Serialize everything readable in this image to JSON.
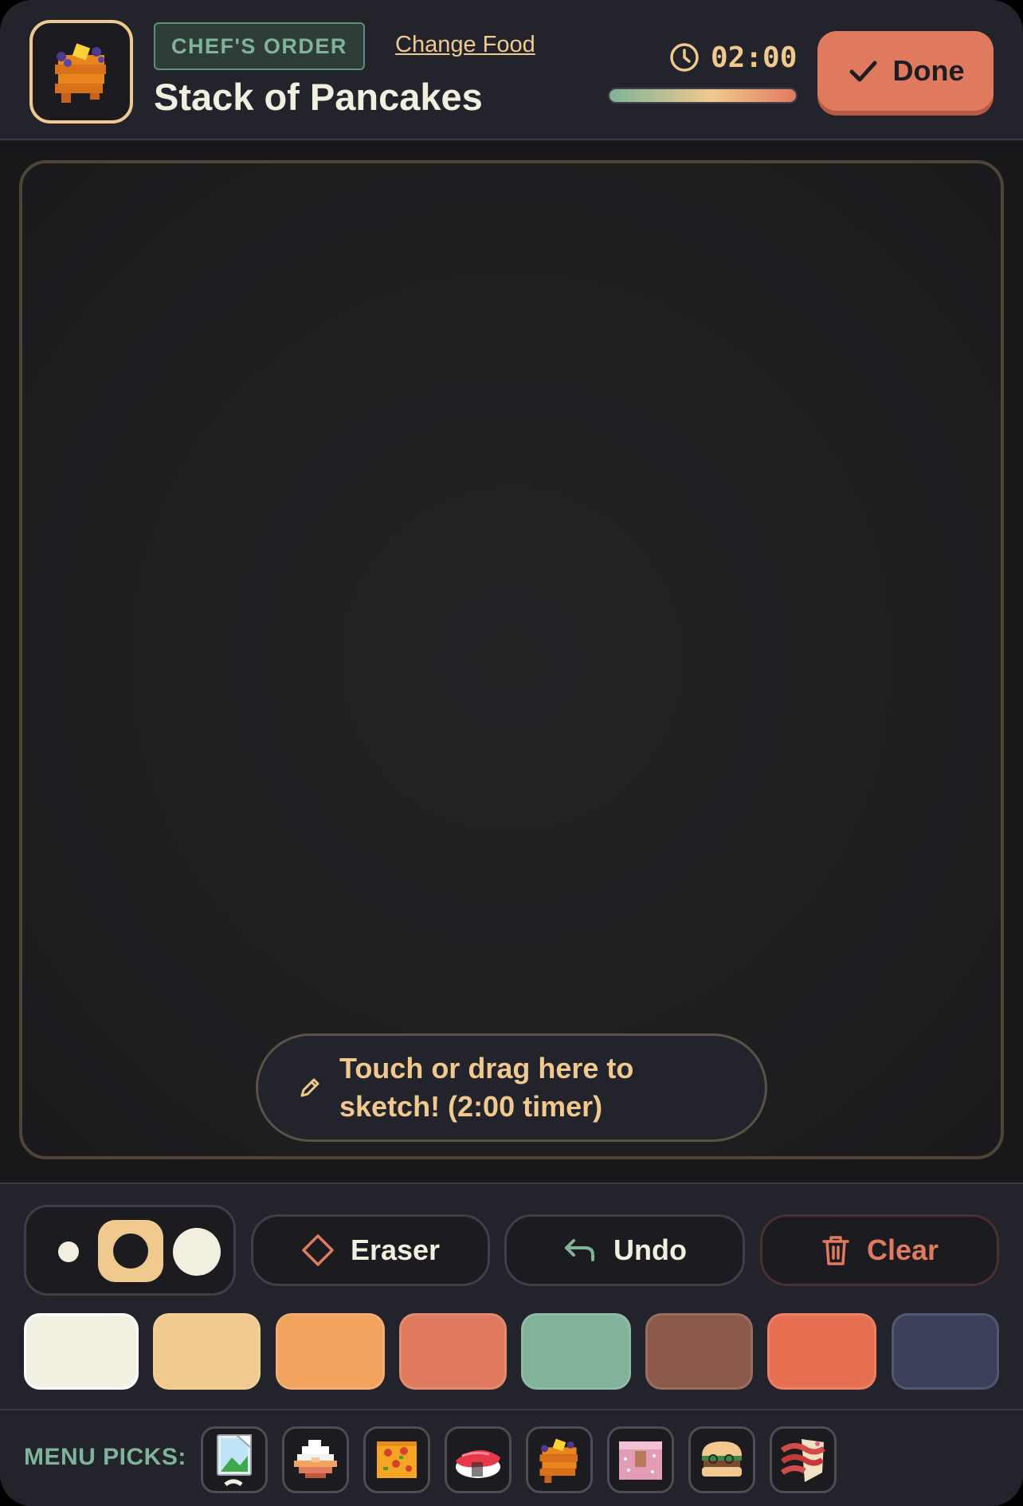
{
  "header": {
    "badge": "CHEF'S ORDER",
    "change_food": "Change Food",
    "title": "Stack of Pancakes",
    "timer": "02:00",
    "timer_progress": 1.0,
    "done_label": "Done"
  },
  "canvas": {
    "hint": "Touch or drag here to sketch! (2:00 timer)"
  },
  "toolbar": {
    "brush_sizes": [
      "small",
      "medium",
      "large"
    ],
    "selected_size": "medium",
    "eraser_label": "Eraser",
    "undo_label": "Undo",
    "clear_label": "Clear"
  },
  "palette": [
    {
      "color": "#f2f0e0",
      "selected": true
    },
    {
      "color": "#f0c98e",
      "selected": false
    },
    {
      "color": "#f2a35e",
      "selected": false
    },
    {
      "color": "#e07a5f",
      "selected": false
    },
    {
      "color": "#81b29a",
      "selected": false
    },
    {
      "color": "#8b5a4a",
      "selected": false
    },
    {
      "color": "#e76f51",
      "selected": false
    },
    {
      "color": "#3d405b",
      "selected": false
    }
  ],
  "menu": {
    "label": "MENU PICKS:",
    "items": [
      "broken-image-icon",
      "rice-bowl-icon",
      "pizza-icon",
      "sushi-icon",
      "pancakes-icon",
      "cake-icon",
      "burger-icon",
      "bacon-icon"
    ]
  },
  "colors": {
    "accent": "#e07a5f",
    "gold": "#f0c98e",
    "green": "#7fb39a",
    "panel": "#23232b"
  }
}
